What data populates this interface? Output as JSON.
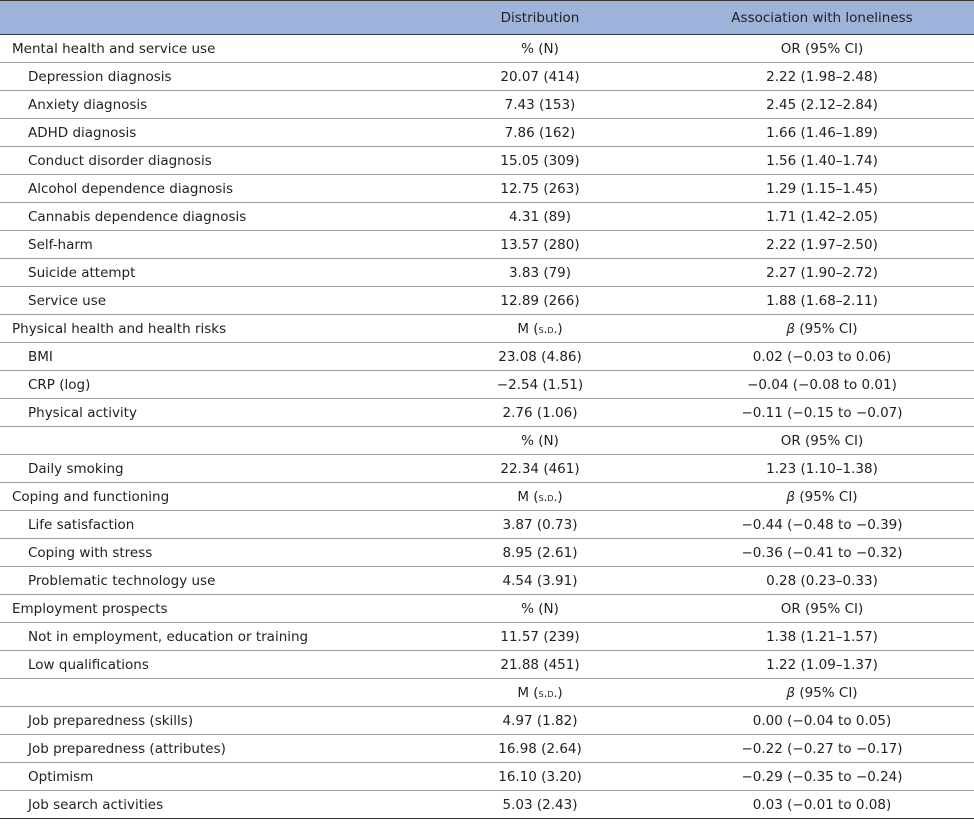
{
  "header": {
    "col1": "",
    "col2": "Distribution",
    "col3": "Association with loneliness"
  },
  "rows": [
    {
      "type": "section",
      "label": "Mental health and service use",
      "dist": "% (N)",
      "assoc": "OR (95% CI)"
    },
    {
      "type": "item",
      "label": "Depression diagnosis",
      "dist": "20.07 (414)",
      "assoc": "2.22 (1.98–2.48)"
    },
    {
      "type": "item",
      "label": "Anxiety diagnosis",
      "dist": "7.43 (153)",
      "assoc": "2.45 (2.12–2.84)"
    },
    {
      "type": "item",
      "label": "ADHD diagnosis",
      "dist": "7.86 (162)",
      "assoc": "1.66 (1.46–1.89)"
    },
    {
      "type": "item",
      "label": "Conduct disorder diagnosis",
      "dist": "15.05 (309)",
      "assoc": "1.56 (1.40–1.74)"
    },
    {
      "type": "item",
      "label": "Alcohol dependence diagnosis",
      "dist": "12.75 (263)",
      "assoc": "1.29 (1.15–1.45)"
    },
    {
      "type": "item",
      "label": "Cannabis dependence diagnosis",
      "dist": "4.31 (89)",
      "assoc": "1.71 (1.42–2.05)"
    },
    {
      "type": "item",
      "label": "Self-harm",
      "dist": "13.57 (280)",
      "assoc": "2.22 (1.97–2.50)"
    },
    {
      "type": "item",
      "label": "Suicide attempt",
      "dist": "3.83 (79)",
      "assoc": "2.27 (1.90–2.72)"
    },
    {
      "type": "item",
      "label": "Service use",
      "dist": "12.89 (266)",
      "assoc": "1.88 (1.68–2.11)"
    },
    {
      "type": "section",
      "label": "Physical health and health risks",
      "dist_pre": "M (",
      "dist_sc": "s.d.",
      "dist_post": ")",
      "assoc_beta": "β",
      "assoc_rest": " (95% CI)"
    },
    {
      "type": "item",
      "label": "BMI",
      "dist": "23.08 (4.86)",
      "assoc": "0.02 (−0.03 to 0.06)"
    },
    {
      "type": "item",
      "label": "CRP (log)",
      "dist": "−2.54 (1.51)",
      "assoc": "−0.04 (−0.08 to 0.01)"
    },
    {
      "type": "item",
      "label": "Physical activity",
      "dist": "2.76 (1.06)",
      "assoc": "−0.11 (−0.15 to −0.07)"
    },
    {
      "type": "section",
      "label": "",
      "dist": "% (N)",
      "assoc": "OR (95% CI)"
    },
    {
      "type": "item",
      "label": "Daily smoking",
      "dist": "22.34 (461)",
      "assoc": "1.23 (1.10–1.38)"
    },
    {
      "type": "section",
      "label": "Coping and functioning",
      "dist_pre": "M (",
      "dist_sc": "s.d.",
      "dist_post": ")",
      "assoc_beta": "β",
      "assoc_rest": " (95% CI)"
    },
    {
      "type": "item",
      "label": "Life satisfaction",
      "dist": "3.87 (0.73)",
      "assoc": "−0.44 (−0.48 to −0.39)"
    },
    {
      "type": "item",
      "label": "Coping with stress",
      "dist": "8.95 (2.61)",
      "assoc": "−0.36 (−0.41 to −0.32)"
    },
    {
      "type": "item",
      "label": "Problematic technology use",
      "dist": "4.54 (3.91)",
      "assoc": "0.28 (0.23–0.33)"
    },
    {
      "type": "section",
      "label": "Employment prospects",
      "dist": "% (N)",
      "assoc": "OR (95% CI)"
    },
    {
      "type": "item",
      "label": "Not in employment, education or training",
      "dist": "11.57 (239)",
      "assoc": "1.38 (1.21–1.57)"
    },
    {
      "type": "item",
      "label": "Low qualifications",
      "dist": "21.88 (451)",
      "assoc": "1.22 (1.09–1.37)"
    },
    {
      "type": "section",
      "label": "",
      "dist_pre": "M (",
      "dist_sc": "s.d.",
      "dist_post": ")",
      "assoc_beta": "β",
      "assoc_rest": " (95% CI)"
    },
    {
      "type": "item",
      "label": "Job preparedness (skills)",
      "dist": "4.97 (1.82)",
      "assoc": "0.00 (−0.04 to 0.05)"
    },
    {
      "type": "item",
      "label": "Job preparedness (attributes)",
      "dist": "16.98 (2.64)",
      "assoc": "−0.22 (−0.27 to −0.17)"
    },
    {
      "type": "item",
      "label": "Optimism",
      "dist": "16.10 (3.20)",
      "assoc": "−0.29 (−0.35 to −0.24)"
    },
    {
      "type": "item",
      "label": "Job search activities",
      "dist": "5.03 (2.43)",
      "assoc": "0.03 (−0.01 to 0.08)"
    }
  ]
}
